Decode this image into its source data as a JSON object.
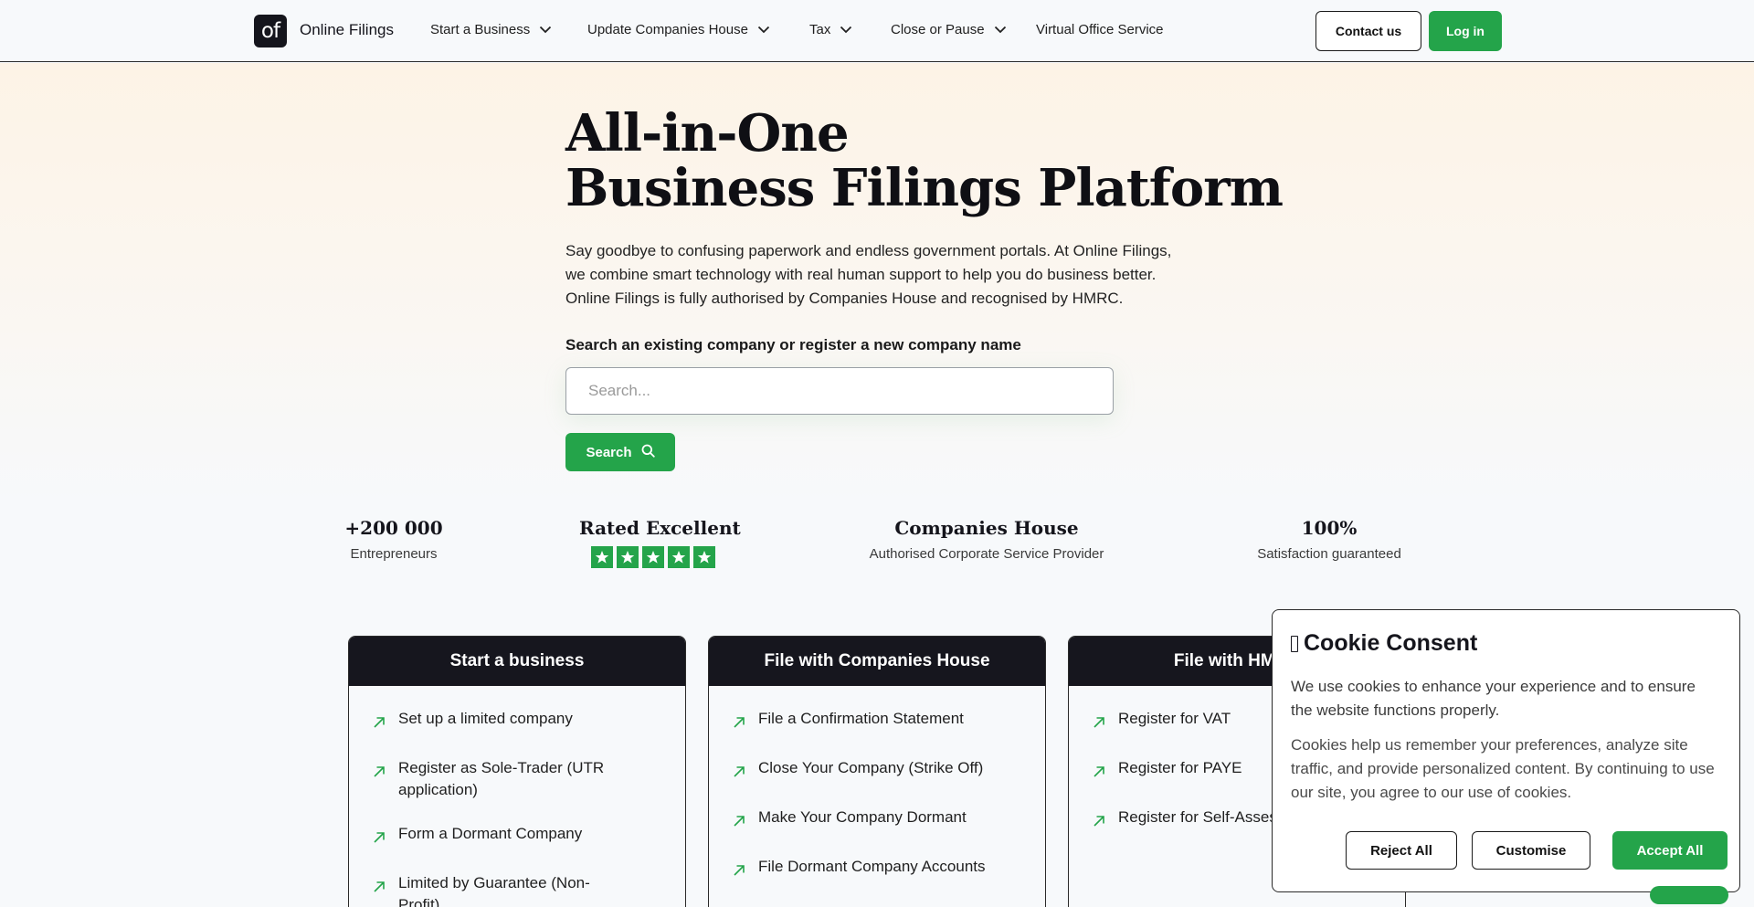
{
  "header": {
    "logo_text": "of",
    "brand": "Online Filings",
    "nav": [
      {
        "label": "Start a Business",
        "dropdown": true
      },
      {
        "label": "Update Companies House",
        "dropdown": true
      },
      {
        "label": "Tax",
        "dropdown": true
      },
      {
        "label": "Close or Pause",
        "dropdown": true
      },
      {
        "label": "Virtual Office Service",
        "dropdown": false
      }
    ],
    "contact_label": "Contact us",
    "login_label": "Log in"
  },
  "hero": {
    "title_line1": "All-in-One",
    "title_line2": "Business Filings Platform",
    "text_line1": "Say goodbye to confusing paperwork and endless government portals. At Online Filings,",
    "text_line2": "we combine smart technology with real human support to help you do business better.",
    "text_line3": "Online Filings is fully authorised by Companies House and recognised by HMRC.",
    "search_label": "Search an existing company or register a new company name",
    "search_placeholder": "Search...",
    "search_value": "",
    "search_button": "Search"
  },
  "stats": [
    {
      "value": "+200 000",
      "label": "Entrepreneurs"
    },
    {
      "value": "Rated Excellent",
      "stars": 5
    },
    {
      "value": "Companies House",
      "label": "Authorised Corporate Service Provider"
    },
    {
      "value": "100%",
      "label": "Satisfaction guaranteed"
    }
  ],
  "cards": [
    {
      "title": "Start a business",
      "items": [
        "Set up a limited company",
        "Register as Sole-Trader (UTR application)",
        "Form a Dormant Company",
        "Limited by Guarantee (Non-Profit)"
      ]
    },
    {
      "title": "File with Companies House",
      "items": [
        "File a Confirmation Statement",
        "Close Your Company (Strike Off)",
        "Make Your Company Dormant",
        "File Dormant Company Accounts"
      ]
    },
    {
      "title": "File with HMRC",
      "items": [
        "Register for VAT",
        "Register for PAYE",
        "Register for Self-Assessment"
      ]
    }
  ],
  "cookie": {
    "title": "Cookie Consent",
    "p1": "We use cookies to enhance your experience and to ensure the website functions properly.",
    "p2": "Cookies help us remember your preferences, analyze site traffic, and provide personalized content. By continuing to use our site, you agree to our use of cookies.",
    "reject": "Reject All",
    "customise": "Customise",
    "accept": "Accept All"
  },
  "colors": {
    "accent": "#24a44a",
    "dark": "#16161e"
  }
}
